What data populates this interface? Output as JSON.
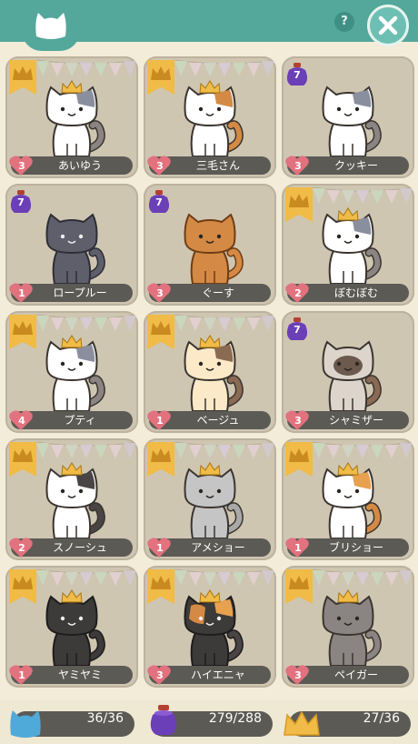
{
  "header": {
    "help_label": "?"
  },
  "colors": {
    "header": "#54a79b",
    "card": "#cfc6b2",
    "namebar": "#5c5a55",
    "heart": "#e2727e",
    "gold": "#f0bb47",
    "purple": "#6b3fb6"
  },
  "cards": [
    {
      "name": "あいゆう",
      "level": "3",
      "badge": "crown",
      "coat": "white",
      "patch": "gray",
      "tail": "gray",
      "hat": "crown"
    },
    {
      "name": "三毛さん",
      "level": "3",
      "badge": "crown",
      "coat": "white",
      "patch": "calico",
      "tail": "orange",
      "hat": "crown"
    },
    {
      "name": "クッキー",
      "level": "3",
      "badge": "purse",
      "purse_count": "7",
      "coat": "white",
      "patch": "gray",
      "tail": "gray",
      "hat": ""
    },
    {
      "name": "ロープルー",
      "level": "1",
      "badge": "purse",
      "purse_count": "7",
      "coat": "slate",
      "patch": "",
      "tail": "slate",
      "hat": ""
    },
    {
      "name": "ぐーす",
      "level": "3",
      "badge": "purse",
      "purse_count": "7",
      "coat": "orange",
      "patch": "",
      "tail": "orange",
      "hat": ""
    },
    {
      "name": "ぼむぼむ",
      "level": "2",
      "badge": "crown",
      "coat": "white",
      "patch": "gray",
      "tail": "gray",
      "hat": "crown"
    },
    {
      "name": "プティ",
      "level": "4",
      "badge": "crown",
      "coat": "white",
      "patch": "gray",
      "tail": "gray",
      "hat": "crown"
    },
    {
      "name": "ベージュ",
      "level": "1",
      "badge": "crown",
      "coat": "cream",
      "patch": "brown",
      "tail": "brown",
      "hat": "crown"
    },
    {
      "name": "シャミザー",
      "level": "3",
      "badge": "purse",
      "purse_count": "7",
      "coat": "siamese",
      "patch": "",
      "tail": "brown",
      "hat": ""
    },
    {
      "name": "スノーシュ",
      "level": "2",
      "badge": "crown",
      "coat": "white",
      "patch": "dark",
      "tail": "dark",
      "hat": "crown"
    },
    {
      "name": "アメショー",
      "level": "1",
      "badge": "crown",
      "coat": "silver",
      "patch": "",
      "tail": "silver",
      "hat": "crown"
    },
    {
      "name": "ブリショー",
      "level": "1",
      "badge": "crown",
      "coat": "white",
      "patch": "orange",
      "tail": "orange",
      "hat": "crown"
    },
    {
      "name": "ヤミヤミ",
      "level": "1",
      "badge": "crown",
      "coat": "black",
      "patch": "",
      "tail": "black",
      "hat": "crown"
    },
    {
      "name": "ハイエニャ",
      "level": "3",
      "badge": "crown",
      "coat": "tortie",
      "patch": "orange",
      "tail": "dark",
      "hat": "crown"
    },
    {
      "name": "ペイガー",
      "level": "3",
      "badge": "crown",
      "coat": "gray",
      "patch": "",
      "tail": "gray",
      "hat": "crown"
    }
  ],
  "footer": {
    "cats_count": "36/36",
    "items_count": "279/288",
    "crowns_count": "27/36"
  }
}
